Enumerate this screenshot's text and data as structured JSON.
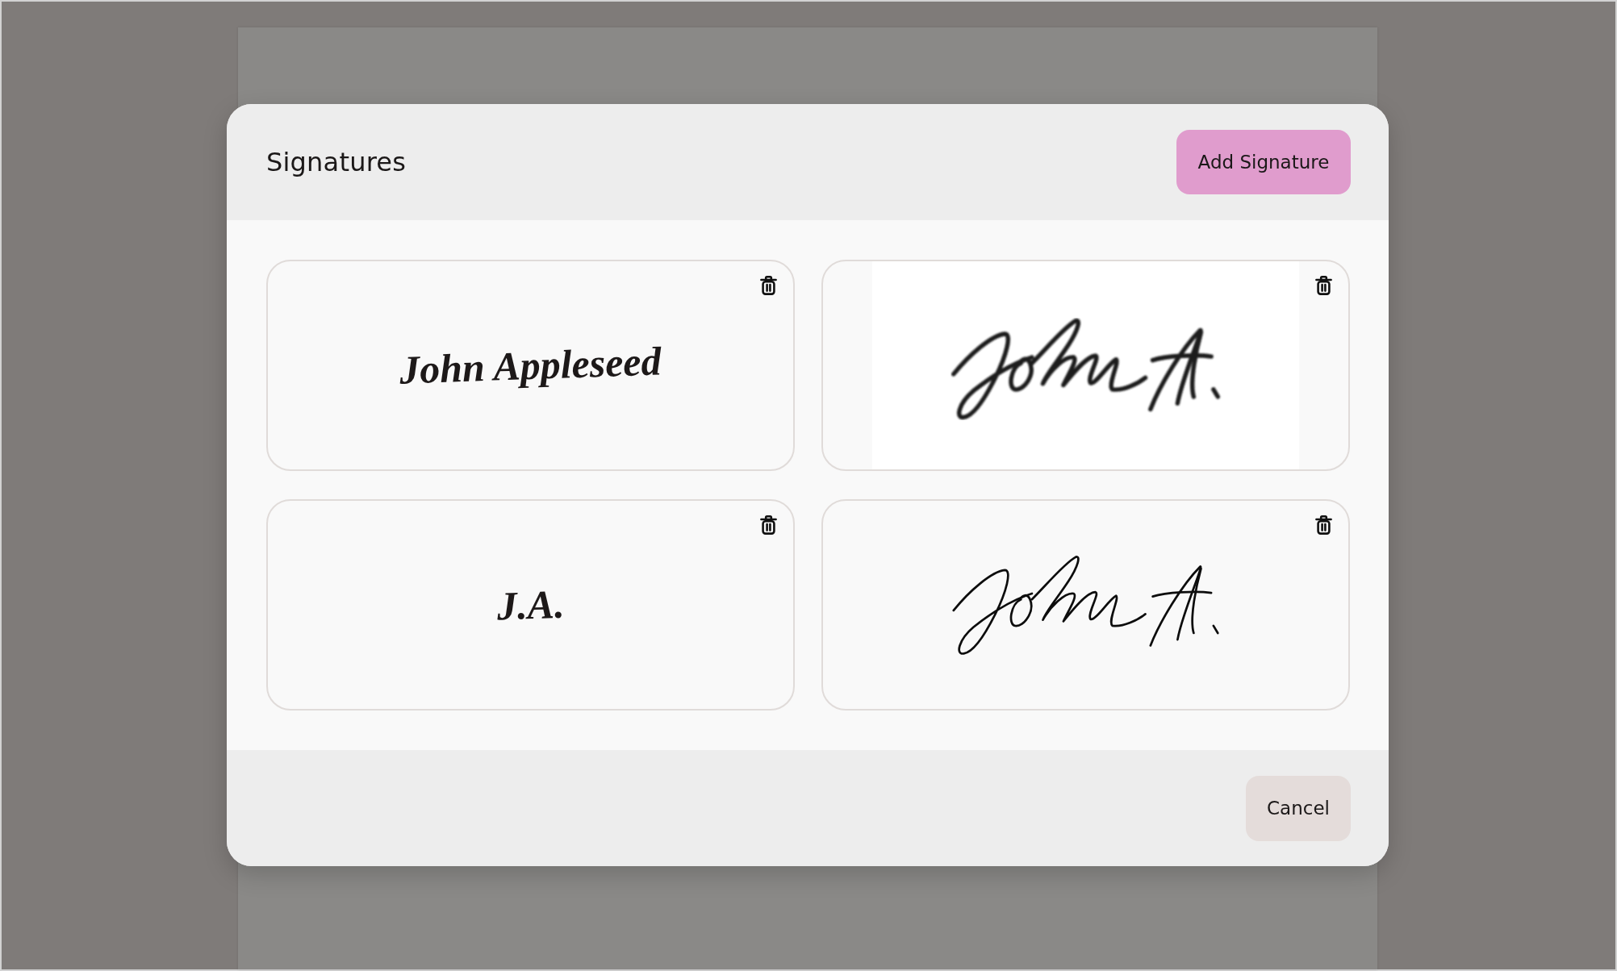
{
  "dialog": {
    "title": "Signatures",
    "add_button": "Add Signature",
    "cancel_button": "Cancel"
  },
  "signatures": [
    {
      "kind": "typed",
      "text": "John Appleseed"
    },
    {
      "kind": "image"
    },
    {
      "kind": "typed",
      "text": "J.A."
    },
    {
      "kind": "drawn"
    }
  ]
}
